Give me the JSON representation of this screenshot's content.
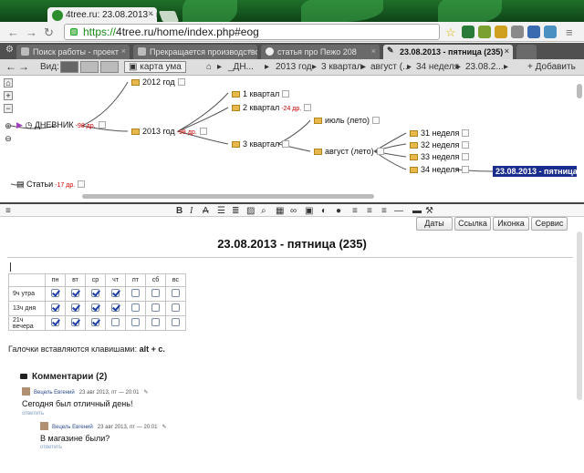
{
  "browser": {
    "tab_title": "4tree.ru: 23.08.2013 - пятни",
    "tab_close": "×",
    "url_https": "https://",
    "url_rest": "4tree.ru/home/index.php#eog"
  },
  "app_tabs": [
    {
      "label": "Поиск работы - проект"
    },
    {
      "label": "Прекращается производство Fo..."
    },
    {
      "label": "статья про Пежо 208"
    },
    {
      "label": "23.08.2013 - пятница (235)"
    }
  ],
  "toolbar": {
    "view_label": "Вид:",
    "mindmap_label": "карта ума",
    "add_label": "+ Добавить",
    "breadcrumbs": [
      "_ДН...",
      "2013 год",
      "3 квартал",
      "август (...",
      "34 неделя",
      "23.08.2..."
    ]
  },
  "tree": {
    "root_label": "ДНЕВНИК",
    "root_count": "-98 др.",
    "stati_label": "Статьи",
    "stati_count": "-17 др.",
    "y2012": "2012 год",
    "y2013": "2013 год",
    "y2013_count": "-98 др.",
    "q1": "1 квартал",
    "q2": "2 квартал",
    "q2_count": "-24 др.",
    "q3": "3 квартал",
    "july": "июль (лето)",
    "aug": "август (лето)",
    "w31": "31 неделя",
    "w32": "32 неделя",
    "w33": "33 неделя",
    "w34": "34 неделя",
    "selected": "23.08.2013 - пятница (235"
  },
  "side_buttons": [
    "Даты",
    "Ссылка",
    "Иконка",
    "Сервис"
  ],
  "note": {
    "title": "23.08.2013 - пятница (235)",
    "days": [
      "пн",
      "вт",
      "ср",
      "чт",
      "пт",
      "сб",
      "вс"
    ],
    "rows": [
      {
        "label": "9ч утра",
        "checks": [
          true,
          true,
          true,
          true,
          false,
          false,
          false
        ]
      },
      {
        "label": "13ч дня",
        "checks": [
          true,
          true,
          true,
          true,
          false,
          false,
          false
        ]
      },
      {
        "label": "21ч вечера",
        "checks": [
          true,
          true,
          true,
          false,
          false,
          false,
          false
        ]
      }
    ],
    "hint_text": "Галочки вставляются клавишами:",
    "hint_keys": "alt + c."
  },
  "comments": {
    "header": "Комментарии (2)",
    "items": [
      {
        "author": "Вецель Евгений",
        "date": "23 авг 2013, пт — 20:01",
        "text": "Сегодня был отличный день!",
        "reply": "ответить"
      },
      {
        "author": "Вецель Евгений",
        "date": "23 авг 2013, пт — 20:01",
        "text": "В магазине были?",
        "reply": "ответить"
      }
    ]
  }
}
